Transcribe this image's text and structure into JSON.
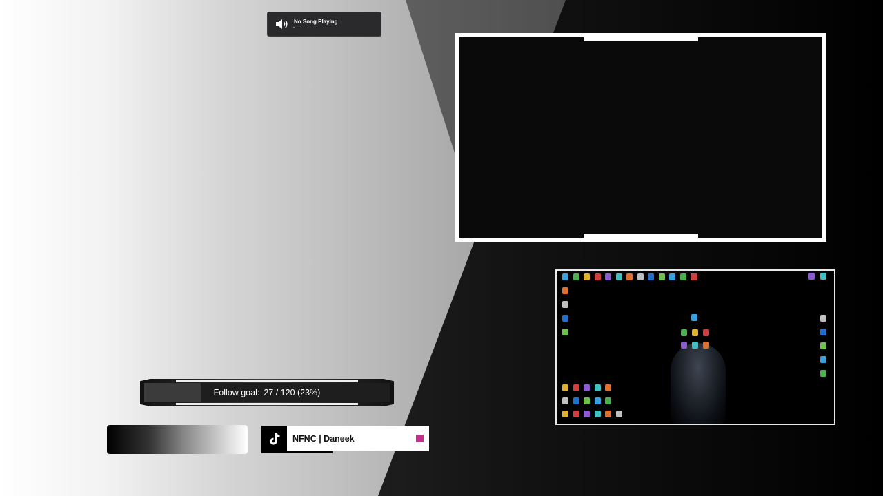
{
  "now_playing": {
    "title": "No Song Playing",
    "icon": "speaker-icon"
  },
  "follow_goal": {
    "label": "Follow goal:",
    "progress_text": "27 / 120 (23%)",
    "current": 27,
    "target": 120,
    "percent": 23
  },
  "social": {
    "platform_icon": "tiktok-icon",
    "handle": "NFNC | Daneek",
    "accent_color": "#c52f8f"
  },
  "colors": {
    "frame_border": "#ffffff",
    "panel_dark": "#2a2a2c"
  }
}
